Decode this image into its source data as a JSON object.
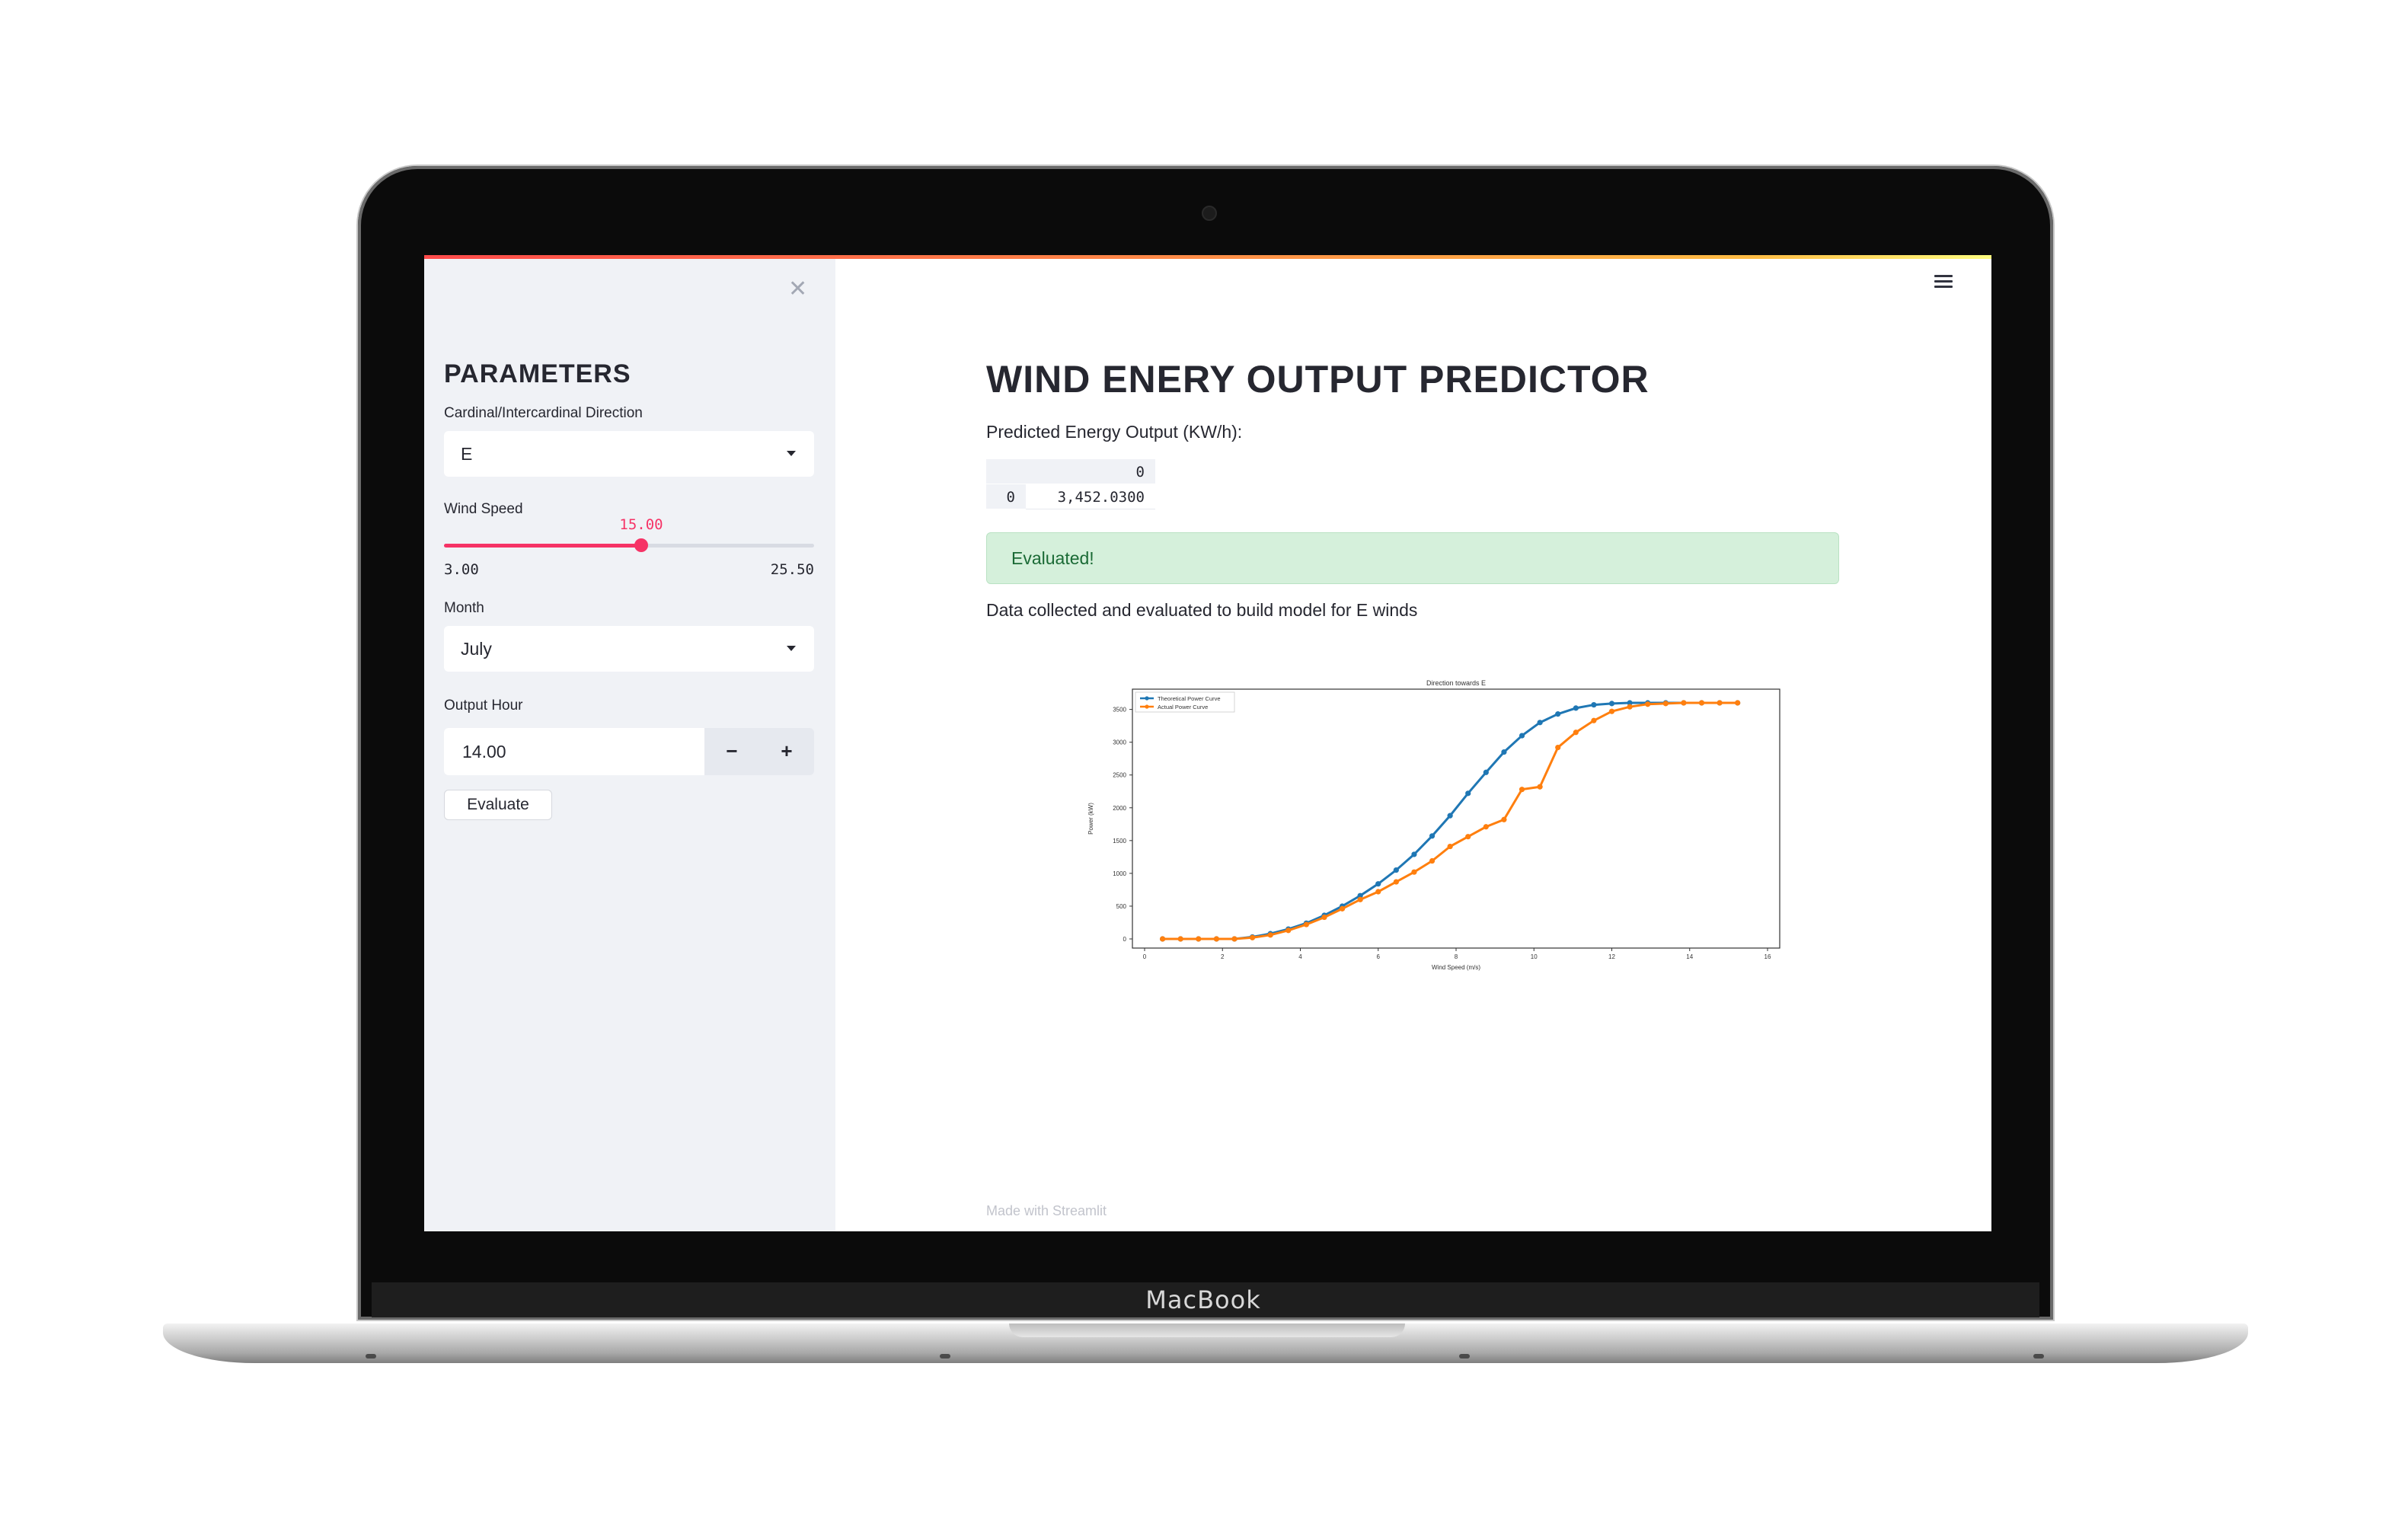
{
  "device": {
    "brand": "MacBook"
  },
  "sidebar": {
    "title": "PARAMETERS",
    "direction": {
      "label": "Cardinal/Intercardinal Direction",
      "value": "E"
    },
    "wind_speed": {
      "label": "Wind Speed",
      "value": "15.00",
      "min": "3.00",
      "max": "25.50",
      "fraction": 0.533
    },
    "month": {
      "label": "Month",
      "value": "July"
    },
    "output_hour": {
      "label": "Output Hour",
      "value": "14.00",
      "minus": "−",
      "plus": "+"
    },
    "evaluate_label": "Evaluate"
  },
  "main": {
    "title": "WIND ENERY OUTPUT PREDICTOR",
    "subtitle": "Predicted Energy Output (KW/h):",
    "table": {
      "column": "0",
      "index": "0",
      "value": "3,452.0300"
    },
    "success": "Evaluated!",
    "description": "Data collected and evaluated to build model for E winds",
    "footer": "Made with Streamlit"
  },
  "colors": {
    "accent": "#f63366",
    "theoretical": "#1f77b4",
    "actual": "#ff7f0e",
    "success_bg": "#d5f0db"
  },
  "chart_data": {
    "type": "line",
    "title": "Direction towards E",
    "xlabel": "Wind Speed (m/s)",
    "ylabel": "Power (kW)",
    "xlim": [
      0,
      26
    ],
    "ylim": [
      0,
      3600
    ],
    "x_ticks": [
      0,
      2,
      4,
      6,
      8,
      10,
      12,
      14,
      16
    ],
    "y_ticks": [
      0,
      500,
      1000,
      1500,
      2000,
      2500,
      3000,
      3500
    ],
    "legend": "top-left",
    "series": [
      {
        "name": "Theoretical Power Curve",
        "x": [
          0.5,
          1,
          1.5,
          2,
          2.5,
          3,
          3.5,
          4,
          4.5,
          5,
          5.5,
          6,
          6.5,
          7,
          7.5,
          8,
          8.5,
          9,
          9.5,
          10,
          10.5,
          11,
          11.5,
          12,
          12.5,
          13,
          13.5,
          14,
          14.5,
          15,
          15.5,
          16,
          16.5
        ],
        "values": [
          0,
          0,
          0,
          0,
          0,
          30,
          80,
          150,
          240,
          360,
          500,
          660,
          840,
          1050,
          1290,
          1570,
          1880,
          2220,
          2540,
          2850,
          3100,
          3300,
          3430,
          3520,
          3570,
          3590,
          3600,
          3600,
          3600,
          3600,
          3600,
          3600,
          3600
        ]
      },
      {
        "name": "Actual Power Curve",
        "x": [
          0.5,
          1,
          1.5,
          2,
          2.5,
          3,
          3.5,
          4,
          4.5,
          5,
          5.5,
          6,
          6.5,
          7,
          7.5,
          8,
          8.5,
          9,
          9.5,
          10,
          10.5,
          11,
          11.5,
          12,
          12.5,
          13,
          13.5,
          14,
          14.5,
          15,
          15.5,
          16,
          16.5
        ],
        "values": [
          0,
          0,
          0,
          0,
          0,
          20,
          60,
          130,
          220,
          330,
          460,
          600,
          720,
          870,
          1020,
          1190,
          1410,
          1560,
          1710,
          1820,
          2280,
          2320,
          2920,
          3150,
          3330,
          3470,
          3540,
          3580,
          3590,
          3600,
          3600,
          3600,
          3600
        ]
      }
    ]
  }
}
